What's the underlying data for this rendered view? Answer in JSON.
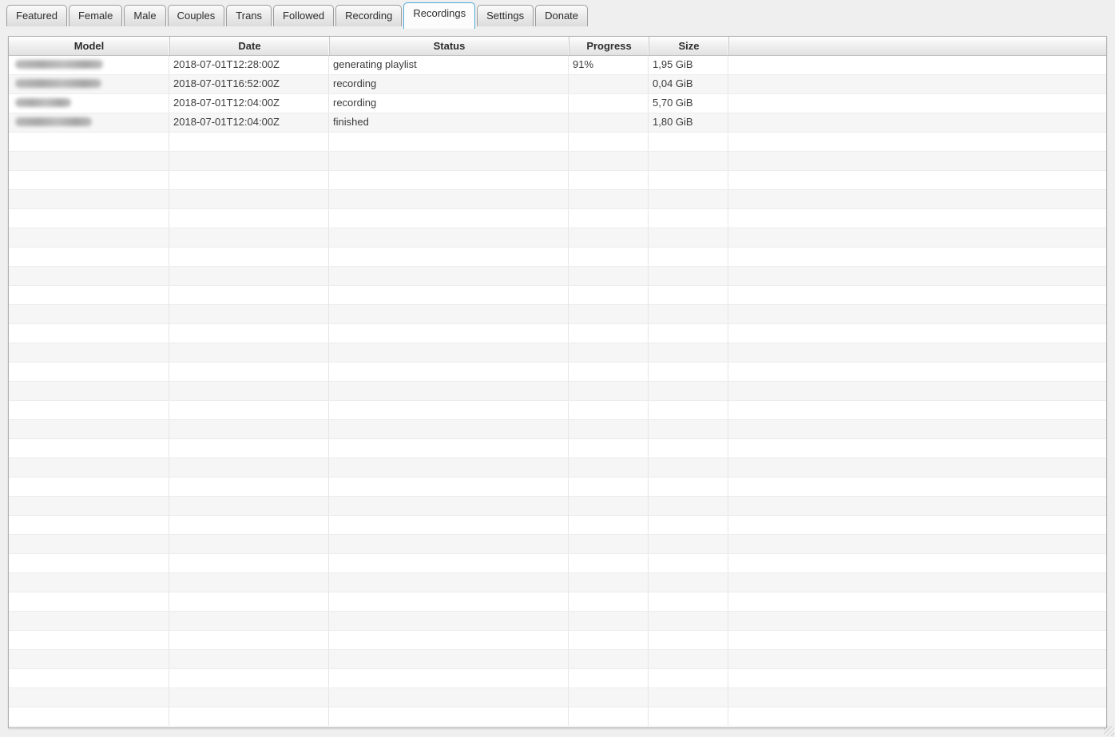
{
  "colors": {
    "window_background": "#efefef",
    "selected_tab_border": "#4ea6d9",
    "row_stripe": "#f6f6f6",
    "header_gradient_bottom": "#e2e2e2"
  },
  "tab_bar": {
    "tabs": [
      {
        "label": "Featured",
        "selected": false
      },
      {
        "label": "Female",
        "selected": false
      },
      {
        "label": "Male",
        "selected": false
      },
      {
        "label": "Couples",
        "selected": false
      },
      {
        "label": "Trans",
        "selected": false
      },
      {
        "label": "Followed",
        "selected": false
      },
      {
        "label": "Recording",
        "selected": false
      },
      {
        "label": "Recordings",
        "selected": true
      },
      {
        "label": "Settings",
        "selected": false
      },
      {
        "label": "Donate",
        "selected": false
      }
    ]
  },
  "recordings_table": {
    "columns": [
      {
        "label": "Model"
      },
      {
        "label": "Date"
      },
      {
        "label": "Status"
      },
      {
        "label": "Progress"
      },
      {
        "label": "Size"
      },
      {
        "label": ""
      }
    ],
    "rows": [
      {
        "model": "",
        "model_redacted": true,
        "model_blob_width": 110,
        "date": "2018-07-01T12:28:00Z",
        "status": "generating playlist",
        "progress": "91%",
        "size": "1,95 GiB"
      },
      {
        "model": "",
        "model_redacted": true,
        "model_blob_width": 108,
        "date": "2018-07-01T16:52:00Z",
        "status": "recording",
        "progress": "",
        "size": "0,04 GiB"
      },
      {
        "model": "",
        "model_redacted": true,
        "model_blob_width": 70,
        "date": "2018-07-01T12:04:00Z",
        "status": "recording",
        "progress": "",
        "size": "5,70 GiB"
      },
      {
        "model": "",
        "model_redacted": true,
        "model_blob_width": 96,
        "date": "2018-07-01T12:04:00Z",
        "status": "finished",
        "progress": "",
        "size": "1,80 GiB"
      }
    ],
    "empty_row_count": 31
  }
}
